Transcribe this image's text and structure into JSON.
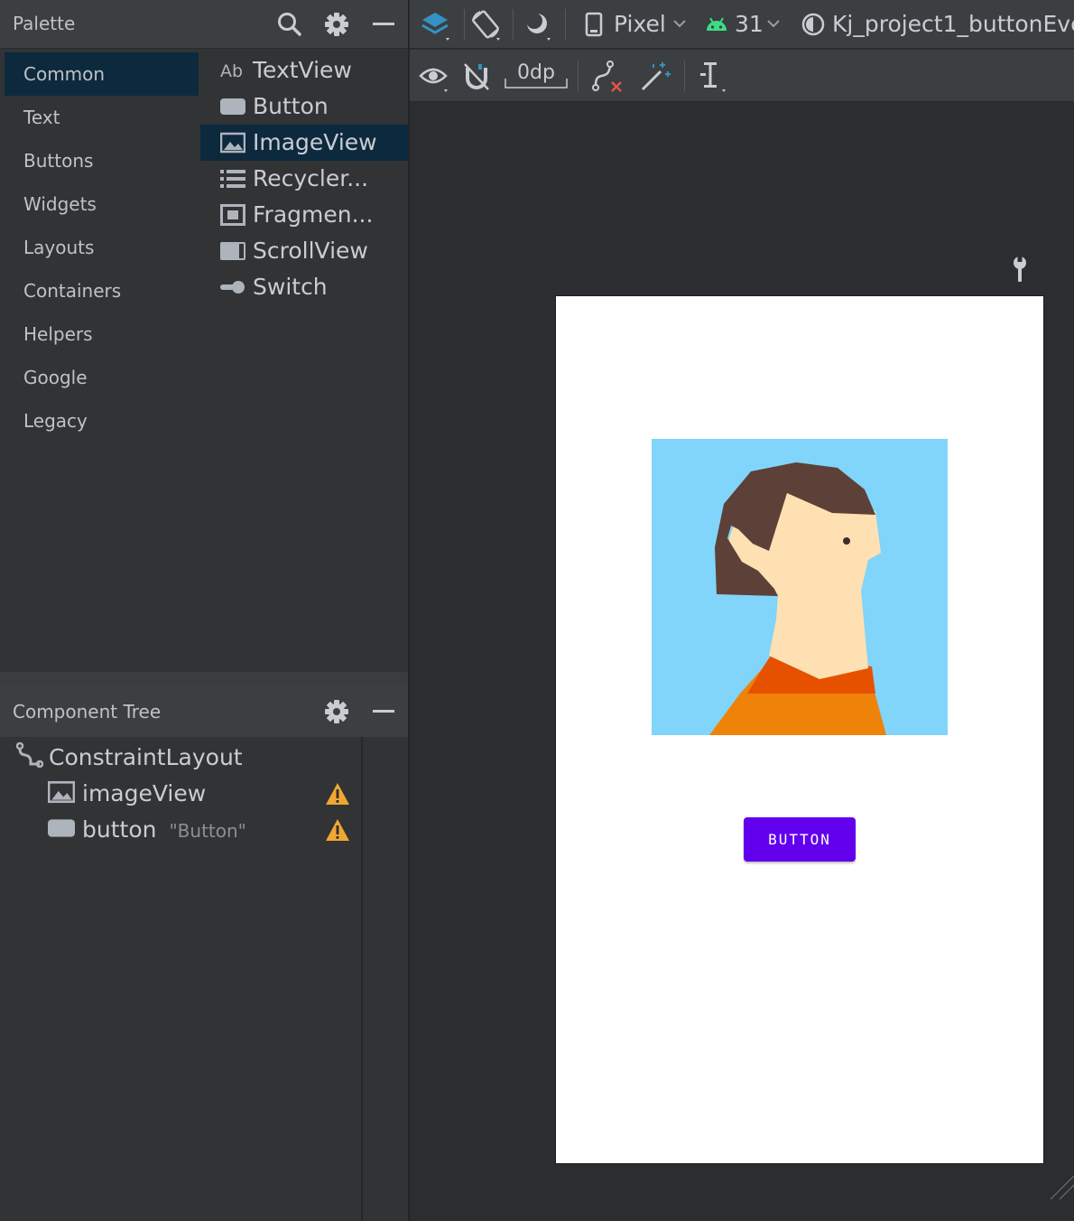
{
  "palette": {
    "title": "Palette",
    "categories": [
      {
        "label": "Common",
        "selected": true
      },
      {
        "label": "Text"
      },
      {
        "label": "Buttons"
      },
      {
        "label": "Widgets"
      },
      {
        "label": "Layouts"
      },
      {
        "label": "Containers"
      },
      {
        "label": "Helpers"
      },
      {
        "label": "Google"
      },
      {
        "label": "Legacy"
      }
    ],
    "items": [
      {
        "label": "TextView",
        "icon": "textview-icon"
      },
      {
        "label": "Button",
        "icon": "button-icon"
      },
      {
        "label": "ImageView",
        "icon": "imageview-icon",
        "selected": true
      },
      {
        "label": "Recycler...",
        "icon": "recyclerview-icon"
      },
      {
        "label": "Fragmen...",
        "icon": "fragment-icon"
      },
      {
        "label": "ScrollView",
        "icon": "scrollview-icon"
      },
      {
        "label": "Switch",
        "icon": "switch-icon"
      }
    ]
  },
  "component_tree": {
    "title": "Component Tree",
    "root": "ConstraintLayout",
    "nodes": [
      {
        "label": "imageView",
        "sublabel": "",
        "warning": true
      },
      {
        "label": "button",
        "sublabel": "\"Button\"",
        "warning": true
      }
    ]
  },
  "toolbar": {
    "device": "Pixel",
    "api_level": "31",
    "project": "Kj_project1_buttonEve",
    "margin": "0dp"
  },
  "preview": {
    "button_label": "BUTTON"
  },
  "colors": {
    "selection": "#0d293e",
    "accent_button": "#6200ee",
    "warning": "#f0a732",
    "android_green": "#3ddc84"
  }
}
